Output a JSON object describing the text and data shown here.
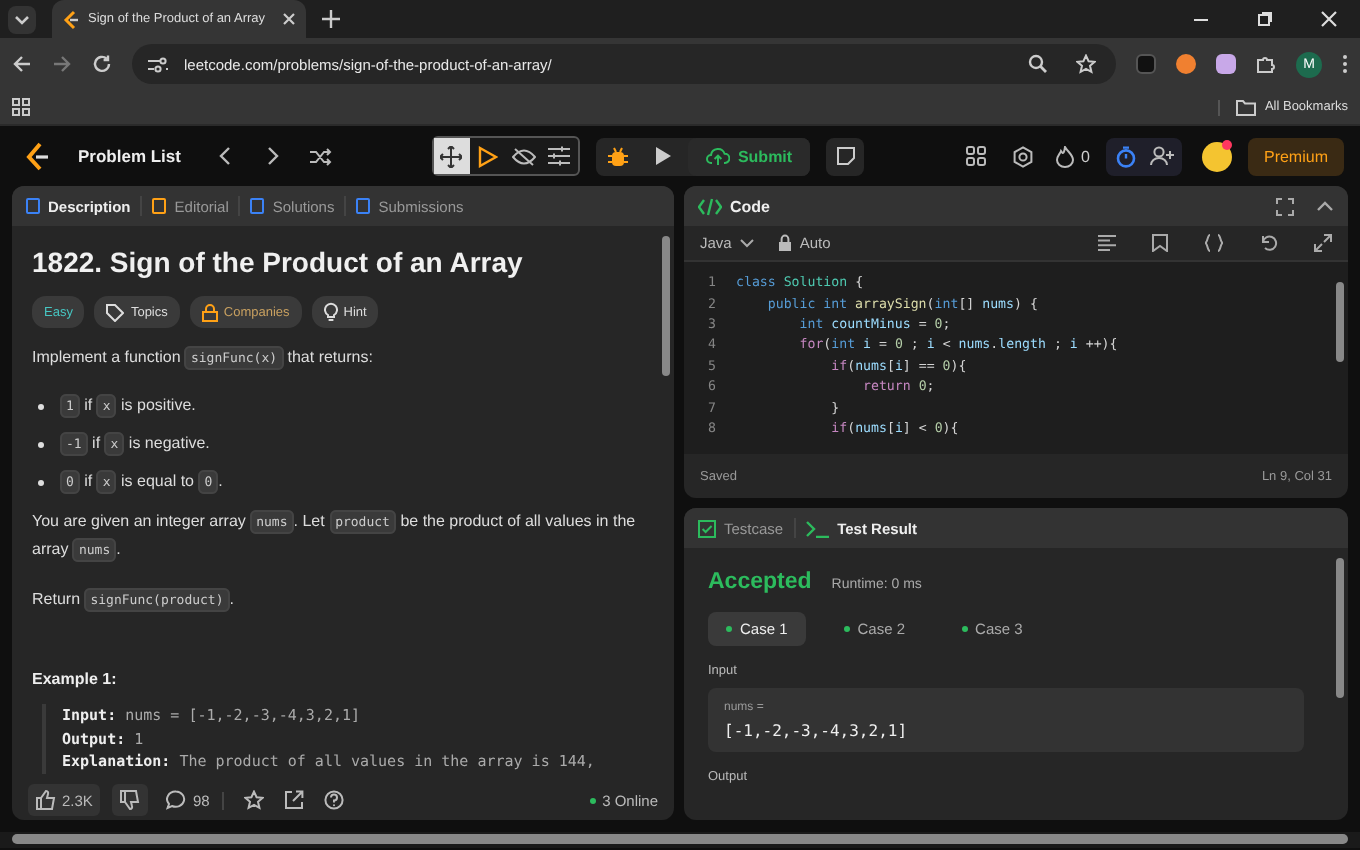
{
  "browser": {
    "tab_title": "Sign of the Product of an Array",
    "url": "leetcode.com/problems/sign-of-the-product-of-an-array/",
    "profile_initial": "M",
    "bookmarks_label": "All Bookmarks"
  },
  "nav": {
    "problem_list": "Problem List",
    "submit": "Submit",
    "streak": "0",
    "premium": "Premium"
  },
  "description": {
    "tabs": [
      {
        "label": "Description",
        "selected": true
      },
      {
        "label": "Editorial",
        "selected": false
      },
      {
        "label": "Solutions",
        "selected": false
      },
      {
        "label": "Submissions",
        "selected": false
      }
    ],
    "title": "1822. Sign of the Product of an Array",
    "tags": [
      {
        "label": "Easy",
        "kind": "difficulty"
      },
      {
        "label": "Topics",
        "kind": "topics"
      },
      {
        "label": "Companies",
        "kind": "companies"
      },
      {
        "label": "Hint",
        "kind": "hint"
      }
    ],
    "blocks": [
      {
        "kind": "paragraph",
        "segments": [
          {
            "kind": "text",
            "text": "Implement a function "
          },
          {
            "kind": "code",
            "text": "signFunc(x)"
          },
          {
            "kind": "text",
            "text": " that returns:"
          }
        ]
      },
      {
        "kind": "bullet",
        "segments": [
          {
            "kind": "code",
            "text": "1"
          },
          {
            "kind": "text",
            "text": " if "
          },
          {
            "kind": "code",
            "text": "x"
          },
          {
            "kind": "text",
            "text": " is positive."
          }
        ]
      },
      {
        "kind": "bullet",
        "segments": [
          {
            "kind": "code",
            "text": "-1"
          },
          {
            "kind": "text",
            "text": " if "
          },
          {
            "kind": "code",
            "text": "x"
          },
          {
            "kind": "text",
            "text": " is negative."
          }
        ]
      },
      {
        "kind": "bullet",
        "segments": [
          {
            "kind": "code",
            "text": "0"
          },
          {
            "kind": "text",
            "text": " if "
          },
          {
            "kind": "code",
            "text": "x"
          },
          {
            "kind": "text",
            "text": " is equal to "
          },
          {
            "kind": "code",
            "text": "0"
          },
          {
            "kind": "text",
            "text": "."
          }
        ]
      },
      {
        "kind": "paragraph",
        "segments": [
          {
            "kind": "text",
            "text": "You are given an integer array "
          },
          {
            "kind": "code",
            "text": "nums"
          },
          {
            "kind": "text",
            "text": ". Let "
          },
          {
            "kind": "code",
            "text": "product"
          },
          {
            "kind": "text",
            "text": " be the product of all values in the array "
          },
          {
            "kind": "code",
            "text": "nums"
          },
          {
            "kind": "text",
            "text": "."
          }
        ]
      },
      {
        "kind": "paragraph",
        "segments": [
          {
            "kind": "text",
            "text": "Return "
          },
          {
            "kind": "code",
            "text": "signFunc(product)"
          },
          {
            "kind": "text",
            "text": "."
          }
        ]
      }
    ],
    "example": {
      "heading": "Example 1:",
      "lines": [
        {
          "label": "Input:",
          "value": "nums = [-1,-2,-3,-4,3,2,1]"
        },
        {
          "label": "Output:",
          "value": "1"
        },
        {
          "label": "Explanation:",
          "value": "The product of all values in the array is 144,"
        }
      ]
    },
    "footer": {
      "likes": "2.3K",
      "comments": "98",
      "online": "3 Online"
    }
  },
  "code": {
    "title": "Code",
    "language": "Java",
    "mode": "Auto",
    "lines": [
      {
        "number": "1",
        "tokens": [
          {
            "kind": "keyword",
            "text": "class "
          },
          {
            "kind": "type",
            "text": "Solution"
          },
          {
            "kind": "plain",
            "text": " {"
          }
        ]
      },
      {
        "number": "2",
        "tokens": [
          {
            "kind": "keyword",
            "text": "    public int "
          },
          {
            "kind": "func",
            "text": "arraySign"
          },
          {
            "kind": "plain",
            "text": "("
          },
          {
            "kind": "keyword",
            "text": "int"
          },
          {
            "kind": "plain",
            "text": "[] "
          },
          {
            "kind": "var",
            "text": "nums"
          },
          {
            "kind": "plain",
            "text": ") {"
          }
        ]
      },
      {
        "number": "3",
        "tokens": [
          {
            "kind": "keyword",
            "text": "        int "
          },
          {
            "kind": "var",
            "text": "countMinus"
          },
          {
            "kind": "plain",
            "text": " = "
          },
          {
            "kind": "number",
            "text": "0"
          },
          {
            "kind": "plain",
            "text": ";"
          }
        ]
      },
      {
        "number": "4",
        "tokens": [
          {
            "kind": "control",
            "text": "        for"
          },
          {
            "kind": "plain",
            "text": "("
          },
          {
            "kind": "keyword",
            "text": "int "
          },
          {
            "kind": "var",
            "text": "i"
          },
          {
            "kind": "plain",
            "text": " = "
          },
          {
            "kind": "number",
            "text": "0"
          },
          {
            "kind": "plain",
            "text": " ; "
          },
          {
            "kind": "var",
            "text": "i"
          },
          {
            "kind": "plain",
            "text": " < "
          },
          {
            "kind": "var",
            "text": "nums"
          },
          {
            "kind": "plain",
            "text": "."
          },
          {
            "kind": "var",
            "text": "length"
          },
          {
            "kind": "plain",
            "text": " ; "
          },
          {
            "kind": "var",
            "text": "i"
          },
          {
            "kind": "plain",
            "text": " ++){"
          }
        ]
      },
      {
        "number": "5",
        "tokens": [
          {
            "kind": "control",
            "text": "            if"
          },
          {
            "kind": "plain",
            "text": "("
          },
          {
            "kind": "var",
            "text": "nums"
          },
          {
            "kind": "plain",
            "text": "["
          },
          {
            "kind": "var",
            "text": "i"
          },
          {
            "kind": "plain",
            "text": "] == "
          },
          {
            "kind": "number",
            "text": "0"
          },
          {
            "kind": "plain",
            "text": "){"
          }
        ]
      },
      {
        "number": "6",
        "tokens": [
          {
            "kind": "control",
            "text": "                return "
          },
          {
            "kind": "number",
            "text": "0"
          },
          {
            "kind": "plain",
            "text": ";"
          }
        ]
      },
      {
        "number": "7",
        "tokens": [
          {
            "kind": "plain",
            "text": "            }"
          }
        ]
      },
      {
        "number": "8",
        "tokens": [
          {
            "kind": "control",
            "text": "            if"
          },
          {
            "kind": "plain",
            "text": "("
          },
          {
            "kind": "var",
            "text": "nums"
          },
          {
            "kind": "plain",
            "text": "["
          },
          {
            "kind": "var",
            "text": "i"
          },
          {
            "kind": "plain",
            "text": "] < "
          },
          {
            "kind": "number",
            "text": "0"
          },
          {
            "kind": "plain",
            "text": "){"
          }
        ]
      }
    ],
    "status": "Saved",
    "cursor": "Ln 9, Col 31"
  },
  "tests": {
    "tabs": [
      {
        "label": "Testcase",
        "selected": false
      },
      {
        "label": "Test Result",
        "selected": true
      }
    ],
    "verdict": "Accepted",
    "runtime": "Runtime: 0 ms",
    "cases": [
      {
        "label": "Case 1",
        "selected": true,
        "passed": true
      },
      {
        "label": "Case 2",
        "selected": false,
        "passed": true
      },
      {
        "label": "Case 3",
        "selected": false,
        "passed": true
      }
    ],
    "input_label": "Input",
    "input_name": "nums =",
    "input_value": "[-1,-2,-3,-4,3,2,1]",
    "output_label": "Output"
  }
}
